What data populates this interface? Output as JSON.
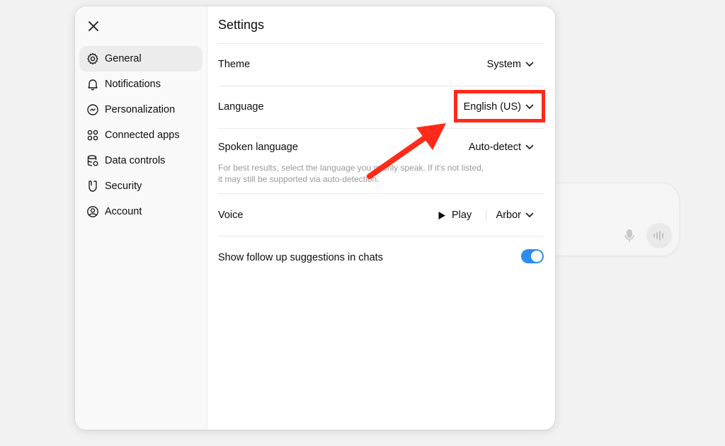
{
  "modal": {
    "title": "Settings",
    "close_icon": "close-icon"
  },
  "sidebar": {
    "items": [
      {
        "label": "General",
        "icon": "gear-icon",
        "active": true
      },
      {
        "label": "Notifications",
        "icon": "bell-icon"
      },
      {
        "label": "Personalization",
        "icon": "personalization-icon"
      },
      {
        "label": "Connected apps",
        "icon": "apps-icon"
      },
      {
        "label": "Data controls",
        "icon": "database-icon"
      },
      {
        "label": "Security",
        "icon": "security-icon"
      },
      {
        "label": "Account",
        "icon": "account-icon"
      }
    ]
  },
  "settings": {
    "theme": {
      "label": "Theme",
      "value": "System"
    },
    "language": {
      "label": "Language",
      "value": "English (US)"
    },
    "spoken_language": {
      "label": "Spoken language",
      "value": "Auto-detect",
      "hint": "For best results, select the language you mainly speak. If it's not listed, it may still be supported via auto-detection."
    },
    "voice": {
      "label": "Voice",
      "play_label": "Play",
      "value": "Arbor"
    },
    "follow_up": {
      "label": "Show follow up suggestions in chats",
      "enabled": true
    }
  },
  "annotation": {
    "highlight_color": "#ff2a1a",
    "arrow_color": "#ff2a1a"
  },
  "colors": {
    "toggle_on": "#2d8cf0"
  }
}
